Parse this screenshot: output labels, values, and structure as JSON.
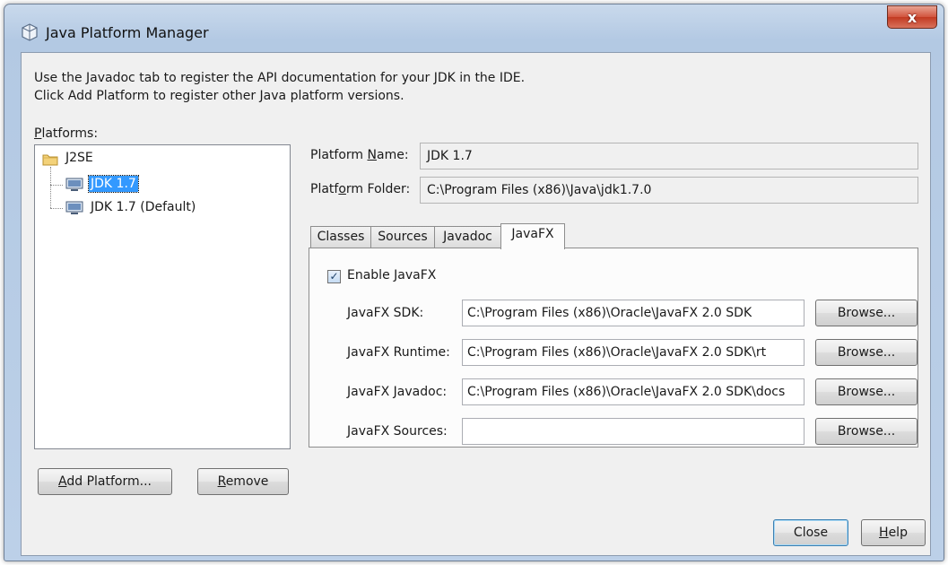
{
  "window": {
    "title": "Java Platform Manager",
    "close_glyph": "x",
    "title_icon": "java-cup-icon"
  },
  "description": {
    "line1": "Use the Javadoc tab to register the API documentation for your JDK in the IDE.",
    "line2": "Click Add Platform to register other Java platform versions."
  },
  "platforms": {
    "label_mnemonic": "P",
    "label_rest": "latforms:",
    "root": {
      "label": "J2SE",
      "icon": "folder-icon"
    },
    "items": [
      {
        "label": "JDK 1.7",
        "selected": true,
        "icon": "monitor-icon"
      },
      {
        "label": "JDK 1.7 (Default)",
        "selected": false,
        "icon": "monitor-icon"
      }
    ]
  },
  "platform_name": {
    "label_pre": "Platform ",
    "label_mnemonic": "N",
    "label_post": "ame:",
    "value": "JDK 1.7"
  },
  "platform_folder": {
    "label_pre": "Platf",
    "label_mnemonic": "o",
    "label_post": "rm Folder:",
    "value": "C:\\Program Files (x86)\\Java\\jdk1.7.0"
  },
  "tabs": [
    {
      "label": "Classes",
      "active": false
    },
    {
      "label": "Sources",
      "active": false
    },
    {
      "label": "Javadoc",
      "active": false
    },
    {
      "label": "JavaFX",
      "active": true
    }
  ],
  "javafx": {
    "enable_label": "Enable JavaFX",
    "enabled": true,
    "check_glyph": "✓",
    "rows": [
      {
        "label": "JavaFX SDK:",
        "value": "C:\\Program Files (x86)\\Oracle\\JavaFX 2.0 SDK",
        "button": "Browse..."
      },
      {
        "label": "JavaFX Runtime:",
        "value": "C:\\Program Files (x86)\\Oracle\\JavaFX 2.0 SDK\\rt",
        "button": "Browse..."
      },
      {
        "label": "JavaFX Javadoc:",
        "value": "C:\\Program Files (x86)\\Oracle\\JavaFX 2.0 SDK\\docs",
        "button": "Browse..."
      },
      {
        "label": "JavaFX Sources:",
        "value": "",
        "button": "Browse..."
      }
    ]
  },
  "buttons": {
    "add_platform_mnemonic": "A",
    "add_platform_rest": "dd Platform...",
    "remove_mnemonic": "R",
    "remove_rest": "emove",
    "close": "Close",
    "help_mnemonic": "H",
    "help_rest": "elp"
  },
  "colors": {
    "selection": "#3399ff",
    "title_gradient_top": "#c9d9ec",
    "close_red": "#c23a22",
    "default_button_border": "#3c7fb1"
  }
}
